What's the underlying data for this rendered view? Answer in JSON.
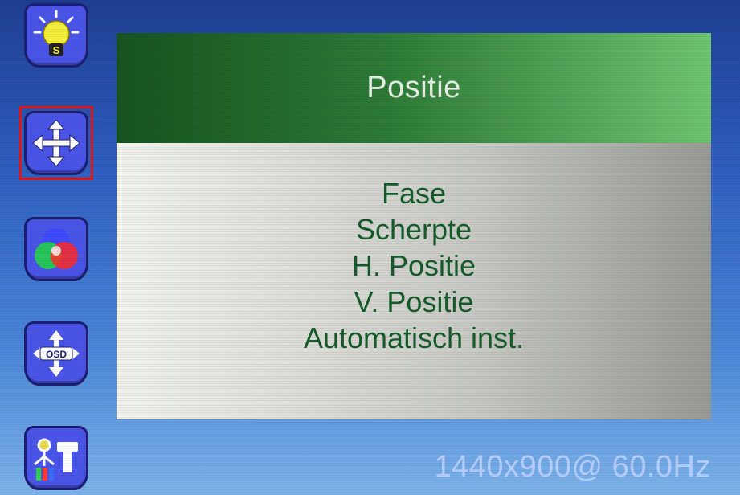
{
  "sidebar": {
    "icons": [
      {
        "name": "brightness-icon",
        "selected": false
      },
      {
        "name": "position-icon",
        "selected": true
      },
      {
        "name": "color-icon",
        "selected": false
      },
      {
        "name": "osd-position-icon",
        "selected": false
      },
      {
        "name": "setup-icon",
        "selected": false
      }
    ],
    "brightness_badge": "S",
    "osd_badge": "OSD"
  },
  "panel": {
    "title": "Positie",
    "items": [
      "Fase",
      "Scherpte",
      "H. Positie",
      "V. Positie",
      "Automatisch inst."
    ]
  },
  "status": {
    "resolution": "1440x900@ 60.0Hz"
  },
  "colors": {
    "selected_frame": "#e11717",
    "header_dark": "#17541f",
    "header_light": "#6fc470",
    "menu_text": "#155c2a",
    "icon_tile": "#4a55e8"
  }
}
